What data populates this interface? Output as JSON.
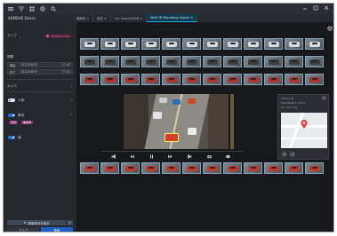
{
  "titlebar": {
    "icons": [
      "menu-icon",
      "collapse-icon",
      "grid-icon",
      "gear-icon",
      "search-icon"
    ]
  },
  "header": {
    "app_title": "AXMOVE Series",
    "tabs": [
      {
        "label": "顔検索 ✕",
        "active": false
      },
      {
        "label": "設定 ✕",
        "active": false
      },
      {
        "label": "Car Search/VMD ✕",
        "active": false
      },
      {
        "label": "Multi-ID Recording Search ✕",
        "active": true
      }
    ]
  },
  "left_panel": {
    "section_label": "ライブ",
    "filter_pill": "Multiple Plate",
    "period_label": "期間",
    "start_label": "開始",
    "start_date": "2021/06/30",
    "start_time": "17:42",
    "end_label": "終了",
    "end_date": "2021/06/30",
    "end_time": "17:52",
    "camera_label": "カメラ",
    "toggle1_label": "人物",
    "toggle2_label": "車両",
    "tags": [
      "赤色",
      "乗用車"
    ],
    "toggle3_label": "顔",
    "save_button": "検索条件を保存",
    "clear_button": "クリア",
    "search_button": "検索"
  },
  "detail_card": {
    "line1": "Camera 01",
    "line2": "2021/06/30 17:47:15",
    "line3": "Car color: Red"
  },
  "colors": {
    "accent": "#1ab0e8",
    "primary_button": "#1f5ec6",
    "pink_tag": "#ff4fa0",
    "map_pin": "#e53935"
  }
}
